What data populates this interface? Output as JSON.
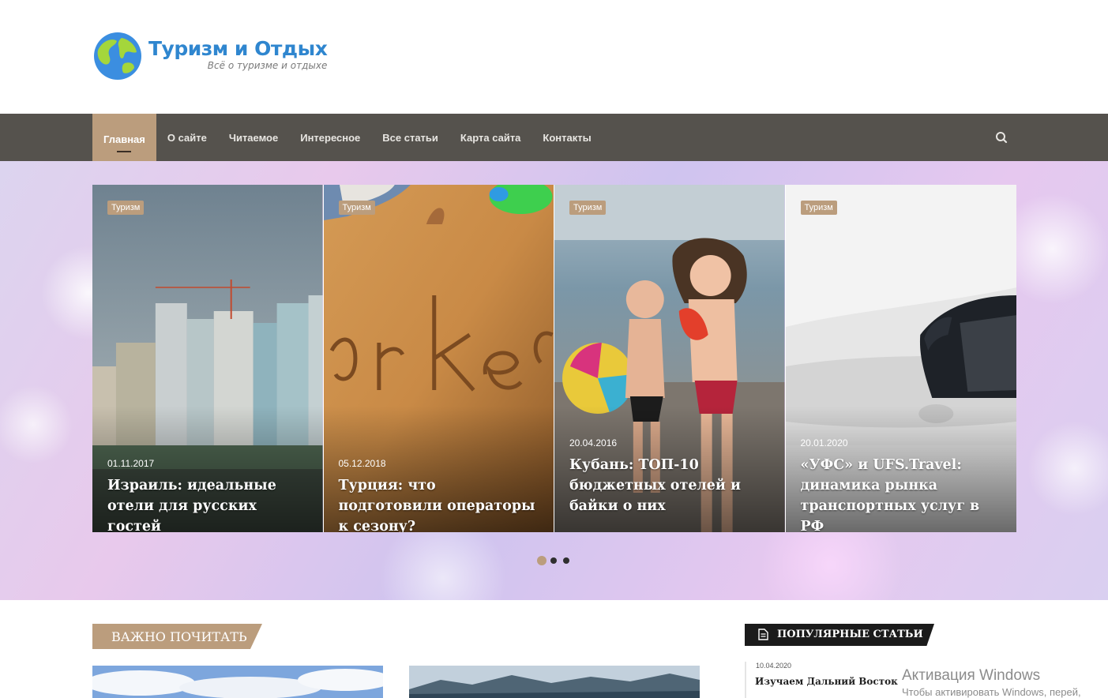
{
  "site": {
    "title": "Туризм и Отдых",
    "tagline": "Всё о туризме и отдыхе",
    "logo_icon": "globe-icon"
  },
  "nav": {
    "items": [
      {
        "label": "Главная",
        "active": true
      },
      {
        "label": "О сайте"
      },
      {
        "label": "Читаемое"
      },
      {
        "label": "Интересное"
      },
      {
        "label": "Все статьи"
      },
      {
        "label": "Карта сайта"
      },
      {
        "label": "Контакты"
      }
    ],
    "search_icon": "search-icon"
  },
  "slider": {
    "slides": [
      {
        "category": "Туризм",
        "date": "01.11.2017",
        "title": "Израиль: идеальные отели для русских гостей"
      },
      {
        "category": "Туризм",
        "date": "05.12.2018",
        "title": "Турция: что подготовили операторы к сезону?"
      },
      {
        "category": "Туризм",
        "date": "20.04.2016",
        "title": "Кубань: ТОП-10 бюджетных отелей и байки о них"
      },
      {
        "category": "Туризм",
        "date": "20.01.2020",
        "title": "«УФС» и UFS.Travel: динамика рынка транспортных услуг в РФ"
      }
    ],
    "dots": 3,
    "active_dot": 0
  },
  "important": {
    "heading": "ВАЖНО ПОЧИТАТЬ"
  },
  "popular": {
    "heading": "ПОПУЛЯРНЫЕ СТАТЬИ",
    "items": [
      {
        "date": "10.04.2020",
        "title": "Изучаем Дальний Восток"
      }
    ]
  },
  "windows_overlay": {
    "title": "Активация Windows",
    "subtitle": "Чтобы активировать Windows, перей,"
  },
  "colors": {
    "accent": "#bb9d7d",
    "nav_bg": "#55524d",
    "logo_blue": "#2f86cf"
  }
}
